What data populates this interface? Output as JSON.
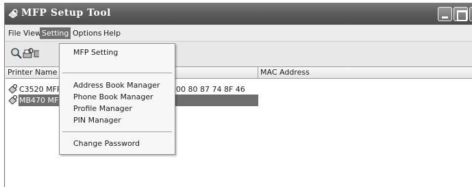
{
  "window": {
    "title": "MFP Setup Tool"
  },
  "menubar": {
    "items": [
      "File",
      "View",
      "Setting",
      "Options",
      "Help"
    ],
    "active": "Setting"
  },
  "toolbar": {
    "icons": [
      "search-icon",
      "printer-gear-icon",
      "printer-partial-icon"
    ]
  },
  "dropdown": {
    "items": [
      "MFP Setting",
      "Address Book Manager",
      "Phone Book Manager",
      "Profile Manager",
      "PIN Manager",
      "Change Password"
    ]
  },
  "list": {
    "columns": [
      "Printer Name",
      "",
      "MAC Address"
    ],
    "rows": [
      {
        "name": "C3520 MFP",
        "mac": "00 80 87 74 8F 46",
        "selected": false
      },
      {
        "name": "MB470 MFP",
        "mac": "",
        "selected": true
      }
    ]
  },
  "colors": {
    "titlebar": "#5e5e5e",
    "menu_highlight": "#6f6f6f",
    "selection": "#6e6e6e"
  }
}
